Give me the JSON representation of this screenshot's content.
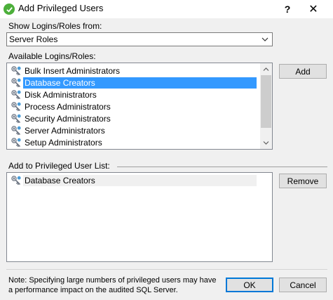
{
  "window": {
    "title": "Add Privileged Users",
    "help_label": "?",
    "close_label": "✕"
  },
  "show_from": {
    "label": "Show Logins/Roles from:",
    "selected": "Server Roles"
  },
  "available": {
    "label": "Available Logins/Roles:",
    "items": [
      "Bulk Insert Administrators",
      "Database Creators",
      "Disk Administrators",
      "Process Administrators",
      "Security Administrators",
      "Server Administrators",
      "Setup Administrators"
    ],
    "selected_index": 1,
    "add_label": "Add"
  },
  "privileged": {
    "label": "Add to Privileged User List:",
    "items": [
      "Database Creators"
    ],
    "remove_label": "Remove"
  },
  "footer": {
    "note": "Note: Specifying large numbers of privileged users may have a performance impact on the audited SQL Server.",
    "ok_label": "OK",
    "cancel_label": "Cancel"
  },
  "colors": {
    "selection": "#3399ff",
    "app_icon": "#4caf3a"
  }
}
